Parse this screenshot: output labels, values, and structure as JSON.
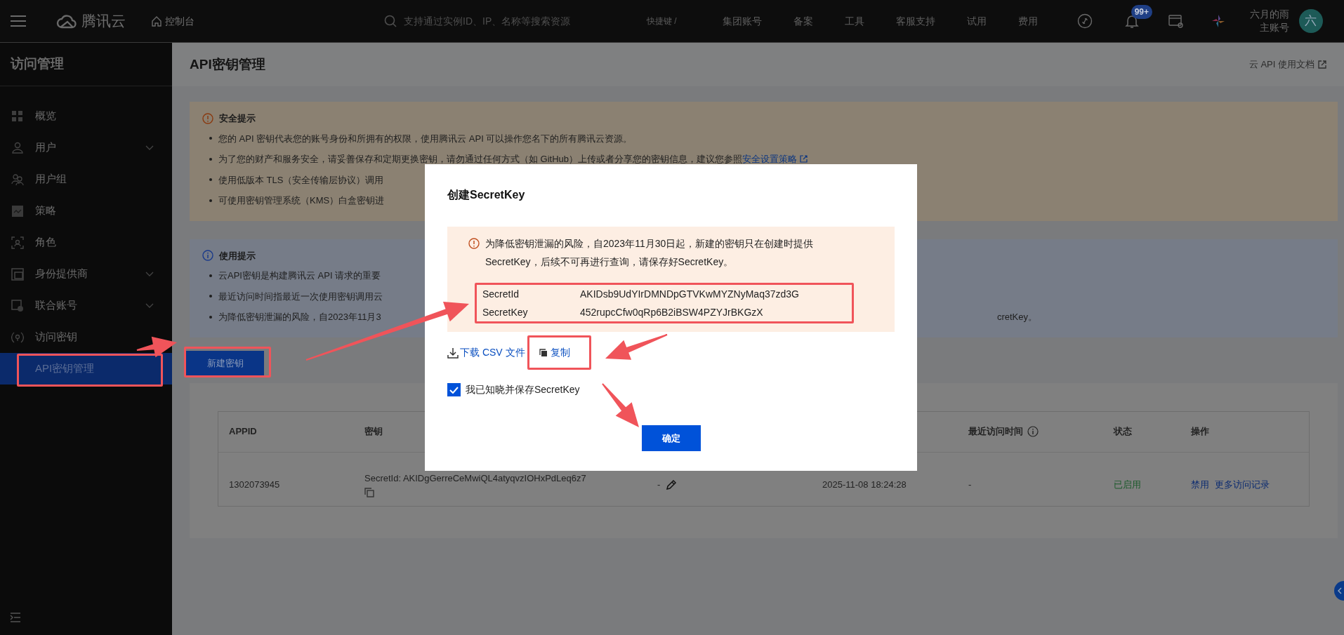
{
  "topbar": {
    "brand": "腾讯云",
    "console": "控制台",
    "search": {
      "placeholder": "支持通过实例ID、IP、名称等搜索资源"
    },
    "shortcut": "快捷键 /",
    "nav": [
      "集团账号",
      "备案",
      "工具",
      "客服支持",
      "试用",
      "费用"
    ],
    "notification_badge": "99+",
    "user": {
      "name": "六月的雨",
      "role": "主账号",
      "avatar": "六"
    }
  },
  "sidebar": {
    "title": "访问管理",
    "items": [
      {
        "label": "概览",
        "expandable": false,
        "selected": false
      },
      {
        "label": "用户",
        "expandable": true,
        "selected": false
      },
      {
        "label": "用户组",
        "expandable": false,
        "selected": false
      },
      {
        "label": "策略",
        "expandable": false,
        "selected": false
      },
      {
        "label": "角色",
        "expandable": false,
        "selected": false
      },
      {
        "label": "身份提供商",
        "expandable": true,
        "selected": false
      },
      {
        "label": "联合账号",
        "expandable": true,
        "selected": false
      },
      {
        "label": "访问密钥",
        "expandable": false,
        "selected": false,
        "children": [
          {
            "label": "API密钥管理",
            "selected": true
          }
        ]
      }
    ]
  },
  "page": {
    "title": "API密钥管理",
    "doc_link": "云 API 使用文档"
  },
  "security_notice": {
    "title": "安全提示",
    "items": [
      {
        "text": "您的 API 密钥代表您的账号身份和所拥有的权限，使用腾讯云 API 可以操作您名下的所有腾讯云资源。"
      },
      {
        "text": "为了您的财产和服务安全，请妥善保存和定期更换密钥，请勿通过任何方式（如 GitHub）上传或者分享您的密钥信息，建议您参照",
        "link": "安全设置策略"
      },
      {
        "text": "使用低版本 TLS（安全传输层协议）调用"
      },
      {
        "text": "可使用密钥管理系统（KMS）白盒密钥进"
      }
    ]
  },
  "usage_notice": {
    "title": "使用提示",
    "items": [
      {
        "text": "云API密钥是构建腾讯云 API 请求的重要"
      },
      {
        "text": "最近访问时间指最近一次使用密钥调用云"
      },
      {
        "text": "为降低密钥泄漏的风险，自2023年11月3",
        "tail": "cretKey。"
      }
    ]
  },
  "create_button": "新建密钥",
  "table": {
    "columns": [
      "APPID",
      "密钥",
      "最近访问时间",
      "状态",
      "操作"
    ],
    "rows": [
      {
        "appid": "1302073945",
        "key": "SecretId: AKIDgGerreCeMwiQL4atyqvzIOHxPdLeq6z7",
        "remark": "-",
        "created": "2025-11-08 18:24:28",
        "last_access": "-",
        "status": "已启用",
        "actions": [
          "禁用",
          "更多访问记录"
        ]
      }
    ]
  },
  "dialog": {
    "title": "创建SecretKey",
    "warning": "为降低密钥泄漏的风险，自2023年11月30日起，新建的密钥只在创建时提供SecretKey，后续不可再进行查询，请保存好SecretKey。",
    "credentials": [
      {
        "label": "SecretId",
        "value": "AKIDsb9UdYIrDMNDpGTVKwMYZNyMaq37zd3G"
      },
      {
        "label": "SecretKey",
        "value": "452rupcCfw0qRp6B2iBSW4PZYJrBKGzX"
      }
    ],
    "download": "下载 CSV 文件",
    "copy": "复制",
    "acknowledge": {
      "label": "我已知晓并保存SecretKey",
      "checked": true
    },
    "confirm": "确定"
  }
}
